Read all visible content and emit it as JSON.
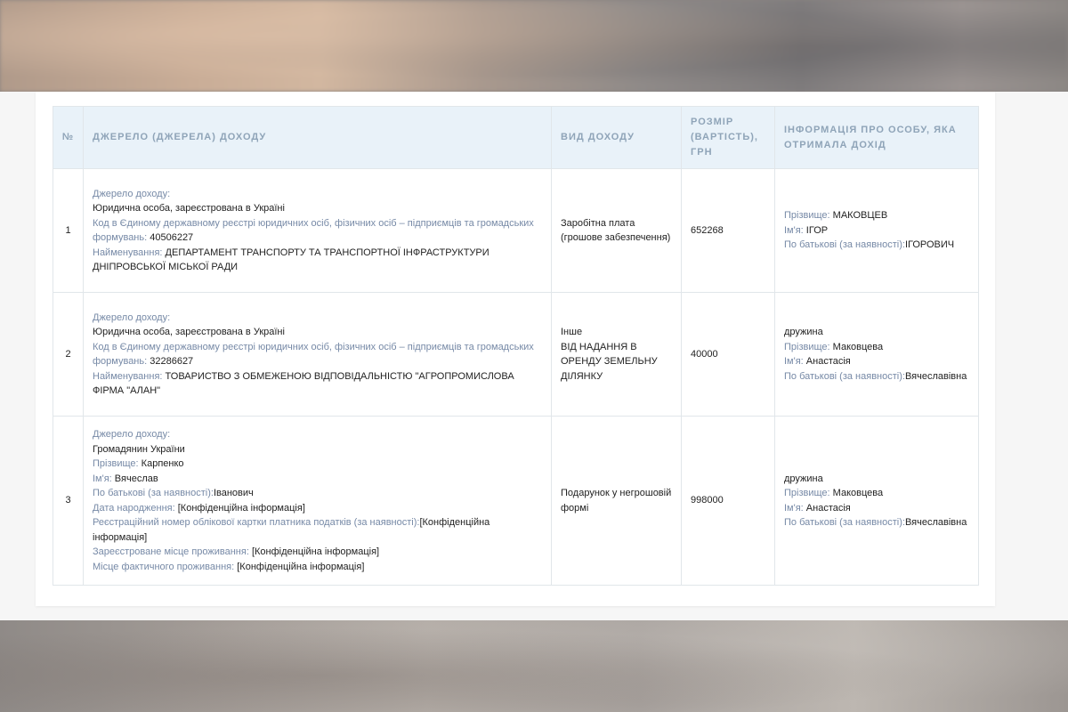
{
  "table": {
    "headers": {
      "num": "№",
      "source": "Джерело (джерела) доходу",
      "type": "Вид доходу",
      "amount": "Розмір (вартість), грн",
      "person": "Інформація про особу, яка отримала дохід"
    },
    "labels": {
      "source": "Джерело доходу:",
      "edrpou": "Код в Єдиному державному реєстрі юридичних осіб, фізичних осіб – підприємців та громадських формувань:",
      "name": "Найменування:",
      "surname": "Прізвище:",
      "firstname": "Ім'я:",
      "patronymic": "По батькові (за наявності):",
      "birthdate": "Дата народження:",
      "tax_number": "Реєстраційний номер облікової картки платника податків (за наявності):",
      "registered_address": "Зареєстроване місце проживання:",
      "actual_address": "Місце фактичного проживання:"
    },
    "rows": [
      {
        "num": "1",
        "source_kind": "Юридична особа, зареєстрована в Україні",
        "edrpou": "40506227",
        "name": "ДЕПАРТАМЕНТ ТРАНСПОРТУ ТА ТРАНСПОРТНОЇ ІНФРАСТРУКТУРИ ДНІПРОВСЬКОЇ МІСЬКОЇ РАДИ",
        "income_type": "Заробітна плата (грошове забезпечення)",
        "amount": "652268",
        "person": {
          "surname": "МАКОВЦЕВ",
          "firstname": "ІГОР",
          "patronymic": "ІГОРОВИЧ"
        }
      },
      {
        "num": "2",
        "source_kind": "Юридична особа, зареєстрована в Україні",
        "edrpou": "32286627",
        "name": "ТОВАРИСТВО З ОБМЕЖЕНОЮ ВІДПОВІДАЛЬНІСТЮ \"АГРОПРОМИСЛОВА ФІРМА \"АЛАН\"",
        "income_type": "Інше",
        "income_detail": "ВІД НАДАННЯ В ОРЕНДУ ЗЕМЕЛЬНУ ДІЛЯНКУ",
        "amount": "40000",
        "person": {
          "relation": "дружина",
          "surname": "Маковцева",
          "firstname": "Анастасія",
          "patronymic": "Вячеславівна"
        }
      },
      {
        "num": "3",
        "source_kind": "Громадянин України",
        "surname": "Карпенко",
        "firstname": "Вячеслав",
        "patronymic": "Іванович",
        "birthdate": "[Конфіденційна інформація]",
        "tax_number": "[Конфіденційна інформація]",
        "registered_address": "[Конфіденційна інформація]",
        "actual_address": "[Конфіденційна інформація]",
        "income_type": "Подарунок у негрошовій формі",
        "amount": "998000",
        "person": {
          "relation": "дружина",
          "surname": "Маковцева",
          "firstname": "Анастасія",
          "patronymic": "Вячеславівна"
        }
      }
    ]
  }
}
